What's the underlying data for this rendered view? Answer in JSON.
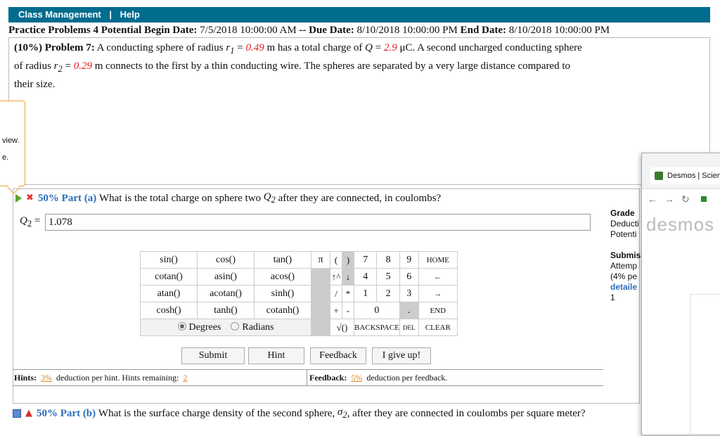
{
  "topbar": {
    "class_management": "Class Management",
    "separator": "|",
    "help": "Help"
  },
  "practice": {
    "title": "Practice Problems 4 Potential",
    "begin_label": "Begin Date:",
    "begin_value": "7/5/2018 10:00:00 AM",
    "sep": "--",
    "due_label": "Due Date:",
    "due_value": "8/10/2018 10:00:00 PM",
    "end_label": "End Date:",
    "end_value": "8/10/2018 10:00:00 PM"
  },
  "problem": {
    "weight": "(10%)",
    "label": "Problem 7:",
    "t1": "A conducting sphere of radius",
    "r1_sym": "r",
    "r1_sub": "1",
    "eq": "=",
    "r1_val": "0.49",
    "t2": "m has a total charge of",
    "q_sym": "Q",
    "q_val": "2.9",
    "t3": "μC. A second uncharged conducting sphere",
    "t4": "of radius",
    "r2_sym": "r",
    "r2_sub": "2",
    "r2_val": "0.29",
    "t5": "m connects to the first by a thin conducting wire. The spheres are separated by a very large distance compared to",
    "t6": "their size."
  },
  "popover": {
    "line1": "view.",
    "line2": "e."
  },
  "part_a": {
    "pct": "50% Part (a)",
    "question": "What is the total charge on sphere two",
    "q_sym": "Q",
    "q_sub": "2",
    "question_end": "after they are connected, in coulombs?",
    "answer_sym": "Q",
    "answer_sub": "2",
    "answer_eq": "=",
    "answer_value": "1.078"
  },
  "calculator": {
    "r1": [
      "sin()",
      "cos()",
      "tan()"
    ],
    "r2": [
      "cotan()",
      "asin()",
      "acos()"
    ],
    "r3": [
      "atan()",
      "acotan()",
      "sinh()"
    ],
    "r4": [
      "cosh()",
      "tanh()",
      "cotanh()"
    ],
    "pi": "π",
    "lparen": "(",
    "rparen": ")",
    "up": "↑^",
    "down": "↓",
    "slash": "/",
    "star": "*",
    "plus": "+",
    "minus": "-",
    "sqrt": "√()",
    "n7": "7",
    "n8": "8",
    "n9": "9",
    "n4": "4",
    "n5": "5",
    "n6": "6",
    "n1": "1",
    "n2": "2",
    "n3": "3",
    "n0": "0",
    "dot": ".",
    "home": "HOME",
    "left": "←",
    "right": "→",
    "end": "END",
    "backspace": "BACKSPACE",
    "del": "DEL",
    "clear": "CLEAR",
    "degrees": "Degrees",
    "radians": "Radians"
  },
  "buttons": {
    "submit": "Submit",
    "hint": "Hint",
    "feedback": "Feedback",
    "give_up": "I give up!"
  },
  "hints": {
    "label": "Hints:",
    "pct": "3%",
    "text": "deduction per hint. Hints remaining:",
    "remaining": "2"
  },
  "feedback": {
    "label": "Feedback:",
    "pct": "5%",
    "text": "deduction per feedback."
  },
  "part_b": {
    "pct": "50% Part (b)",
    "question": "What is the surface charge density of the second sphere,",
    "sym": "σ",
    "sub": "2",
    "question_end": ", after they are connected in coulombs per square meter?"
  },
  "side": {
    "grade": "Grade",
    "deduct": "Deducti",
    "potential": "Potenti",
    "submis": "Submis",
    "attempt": "Attemp",
    "pct": "(4% pe",
    "detailed": "detaile",
    "one": "1"
  },
  "desmos": {
    "tab_title": "Desmos | Scien",
    "brand": "desmos"
  }
}
